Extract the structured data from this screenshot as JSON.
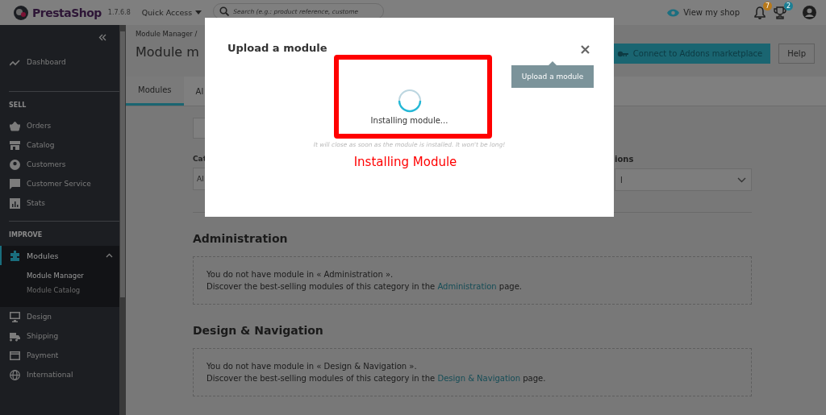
{
  "header": {
    "logo": "PrestaShop",
    "version": "1.7.6.8",
    "quick_access": "Quick Access",
    "search": {
      "placeholder": "Search (e.g.: product reference, custome"
    },
    "view_shop": "View my shop",
    "notifications": [
      {
        "kind": "bell",
        "count": "7",
        "color": "#b8791a"
      },
      {
        "kind": "trophy",
        "count": "2",
        "color": "#1c7f94"
      }
    ]
  },
  "sidebar": {
    "sections": [
      {
        "items": [
          {
            "kind": "dashboard",
            "label": "Dashboard",
            "selected": false
          }
        ]
      },
      {
        "title": "SELL",
        "items": [
          {
            "kind": "orders",
            "label": "Orders",
            "selected": false
          },
          {
            "kind": "catalog",
            "label": "Catalog",
            "selected": false
          },
          {
            "kind": "customers",
            "label": "Customers",
            "selected": false
          },
          {
            "kind": "service",
            "label": "Customer Service",
            "selected": false
          },
          {
            "kind": "stats",
            "label": "Stats",
            "selected": false
          }
        ]
      },
      {
        "title": "IMPROVE",
        "items": [
          {
            "kind": "modules",
            "label": "Modules",
            "selected": true,
            "expanded": true,
            "children": [
              {
                "label": "Module Manager",
                "selected": true
              },
              {
                "label": "Module Catalog",
                "selected": false
              }
            ]
          },
          {
            "kind": "design",
            "label": "Design",
            "selected": false
          },
          {
            "kind": "shipping",
            "label": "Shipping",
            "selected": false
          },
          {
            "kind": "payment",
            "label": "Payment",
            "selected": false
          },
          {
            "kind": "international",
            "label": "International",
            "selected": false
          }
        ]
      }
    ]
  },
  "page": {
    "breadcrumb": "Module Manager /",
    "title": "Module m",
    "buttons": [
      "Connect to Addons marketplace",
      "Help"
    ],
    "tabs": [
      {
        "label": "Modules",
        "selected": true
      },
      {
        "label": "Al",
        "selected": false
      }
    ],
    "filters": [
      {
        "label": "Cat",
        "value": "Al"
      },
      {
        "label": "ions",
        "value": "l"
      }
    ],
    "sections": [
      {
        "title": "Administration",
        "message": "You do not have module in « Administration ».",
        "discover": "Discover the best-selling modules of this category in the",
        "link": "Administration",
        "tail": "page."
      },
      {
        "title": "Design & Navigation",
        "message": "You do not have module in « Design & Navigation ».",
        "discover": "Discover the best-selling modules of this category in the",
        "link": "Design & Navigation",
        "tail": "page."
      }
    ]
  },
  "modal": {
    "title": "Upload a module",
    "tooltip": "Upload a module",
    "status": "Installing module...",
    "note": "It will close as soon as the module is installed. It won't be long!",
    "annotation": "Installing Module"
  }
}
